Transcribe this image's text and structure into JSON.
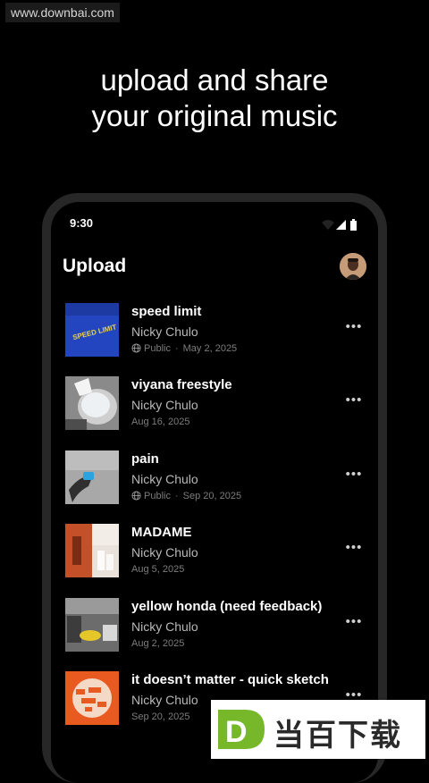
{
  "watermark": {
    "url": "www.downbai.com"
  },
  "headline": {
    "line1": "upload and share",
    "line2": "your original music"
  },
  "status_bar": {
    "time": "9:30"
  },
  "header": {
    "title": "Upload"
  },
  "tracks": [
    {
      "title": "speed limit",
      "artist": "Nicky Chulo",
      "visibility": "Public",
      "separator": "·",
      "date": "May 2, 2025",
      "more": "•••"
    },
    {
      "title": "viyana freestyle",
      "artist": "Nicky Chulo",
      "visibility": "",
      "separator": "",
      "date": "Aug 16, 2025",
      "more": "•••"
    },
    {
      "title": "pain",
      "artist": "Nicky Chulo",
      "visibility": "Public",
      "separator": "·",
      "date": "Sep 20, 2025",
      "more": "•••"
    },
    {
      "title": "MADAME",
      "artist": "Nicky Chulo",
      "visibility": "",
      "separator": "",
      "date": "Aug 5, 2025",
      "more": "•••"
    },
    {
      "title": "yellow honda (need feedback)",
      "artist": "Nicky Chulo",
      "visibility": "",
      "separator": "",
      "date": "Aug 2, 2025",
      "more": "•••"
    },
    {
      "title": "it doesn’t matter - quick sketch",
      "artist": "Nicky Chulo",
      "visibility": "",
      "separator": "",
      "date": "Sep 20, 2025",
      "more": "•••"
    }
  ],
  "brand_banner": {
    "text": "当百下载",
    "logo_letter": "D"
  },
  "colors": {
    "background": "#000000",
    "phone_frame": "#272727",
    "muted_text": "#b8b8b8",
    "meta_text": "#7c7c7c"
  },
  "icons": [
    "wifi-icon",
    "signal-icon",
    "battery-icon",
    "globe-icon",
    "more-icon"
  ]
}
